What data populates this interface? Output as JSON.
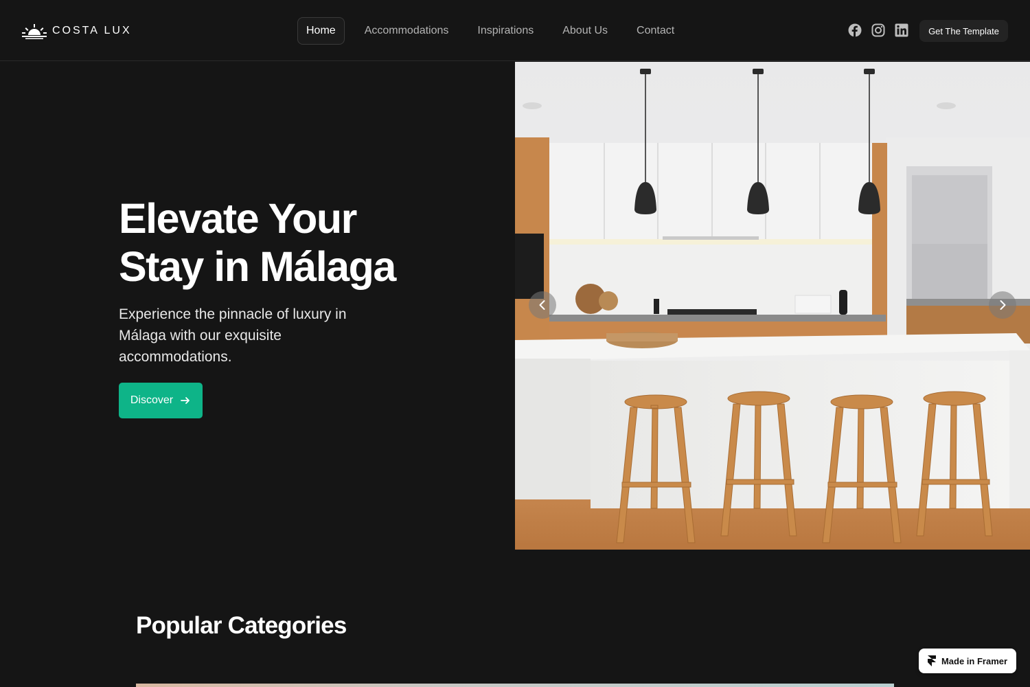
{
  "brand": {
    "name": "COSTA LUX",
    "logo_icon": "sunrise-icon"
  },
  "nav": {
    "items": [
      {
        "label": "Home",
        "active": true
      },
      {
        "label": "Accommodations",
        "active": false
      },
      {
        "label": "Inspirations",
        "active": false
      },
      {
        "label": "About Us",
        "active": false
      },
      {
        "label": "Contact",
        "active": false
      }
    ],
    "socials": [
      "facebook-icon",
      "instagram-icon",
      "linkedin-icon"
    ],
    "cta_label": "Get The Template"
  },
  "hero": {
    "title_line1": "Elevate Your",
    "title_line2": "Stay in Málaga",
    "subtitle": "Experience the pinnacle of luxury in Málaga with our exquisite accommodations.",
    "button_label": "Discover",
    "button_icon": "arrow-right-icon",
    "accent_color": "#0eb488"
  },
  "carousel": {
    "prev_icon": "chevron-left-icon",
    "next_icon": "chevron-right-icon"
  },
  "categories": {
    "title": "Popular Categories"
  },
  "badge": {
    "label": "Made in Framer",
    "icon": "framer-icon"
  },
  "colors": {
    "background": "#151515",
    "accent": "#0eb488",
    "text": "#ffffff",
    "muted": "#b4b4b4"
  }
}
